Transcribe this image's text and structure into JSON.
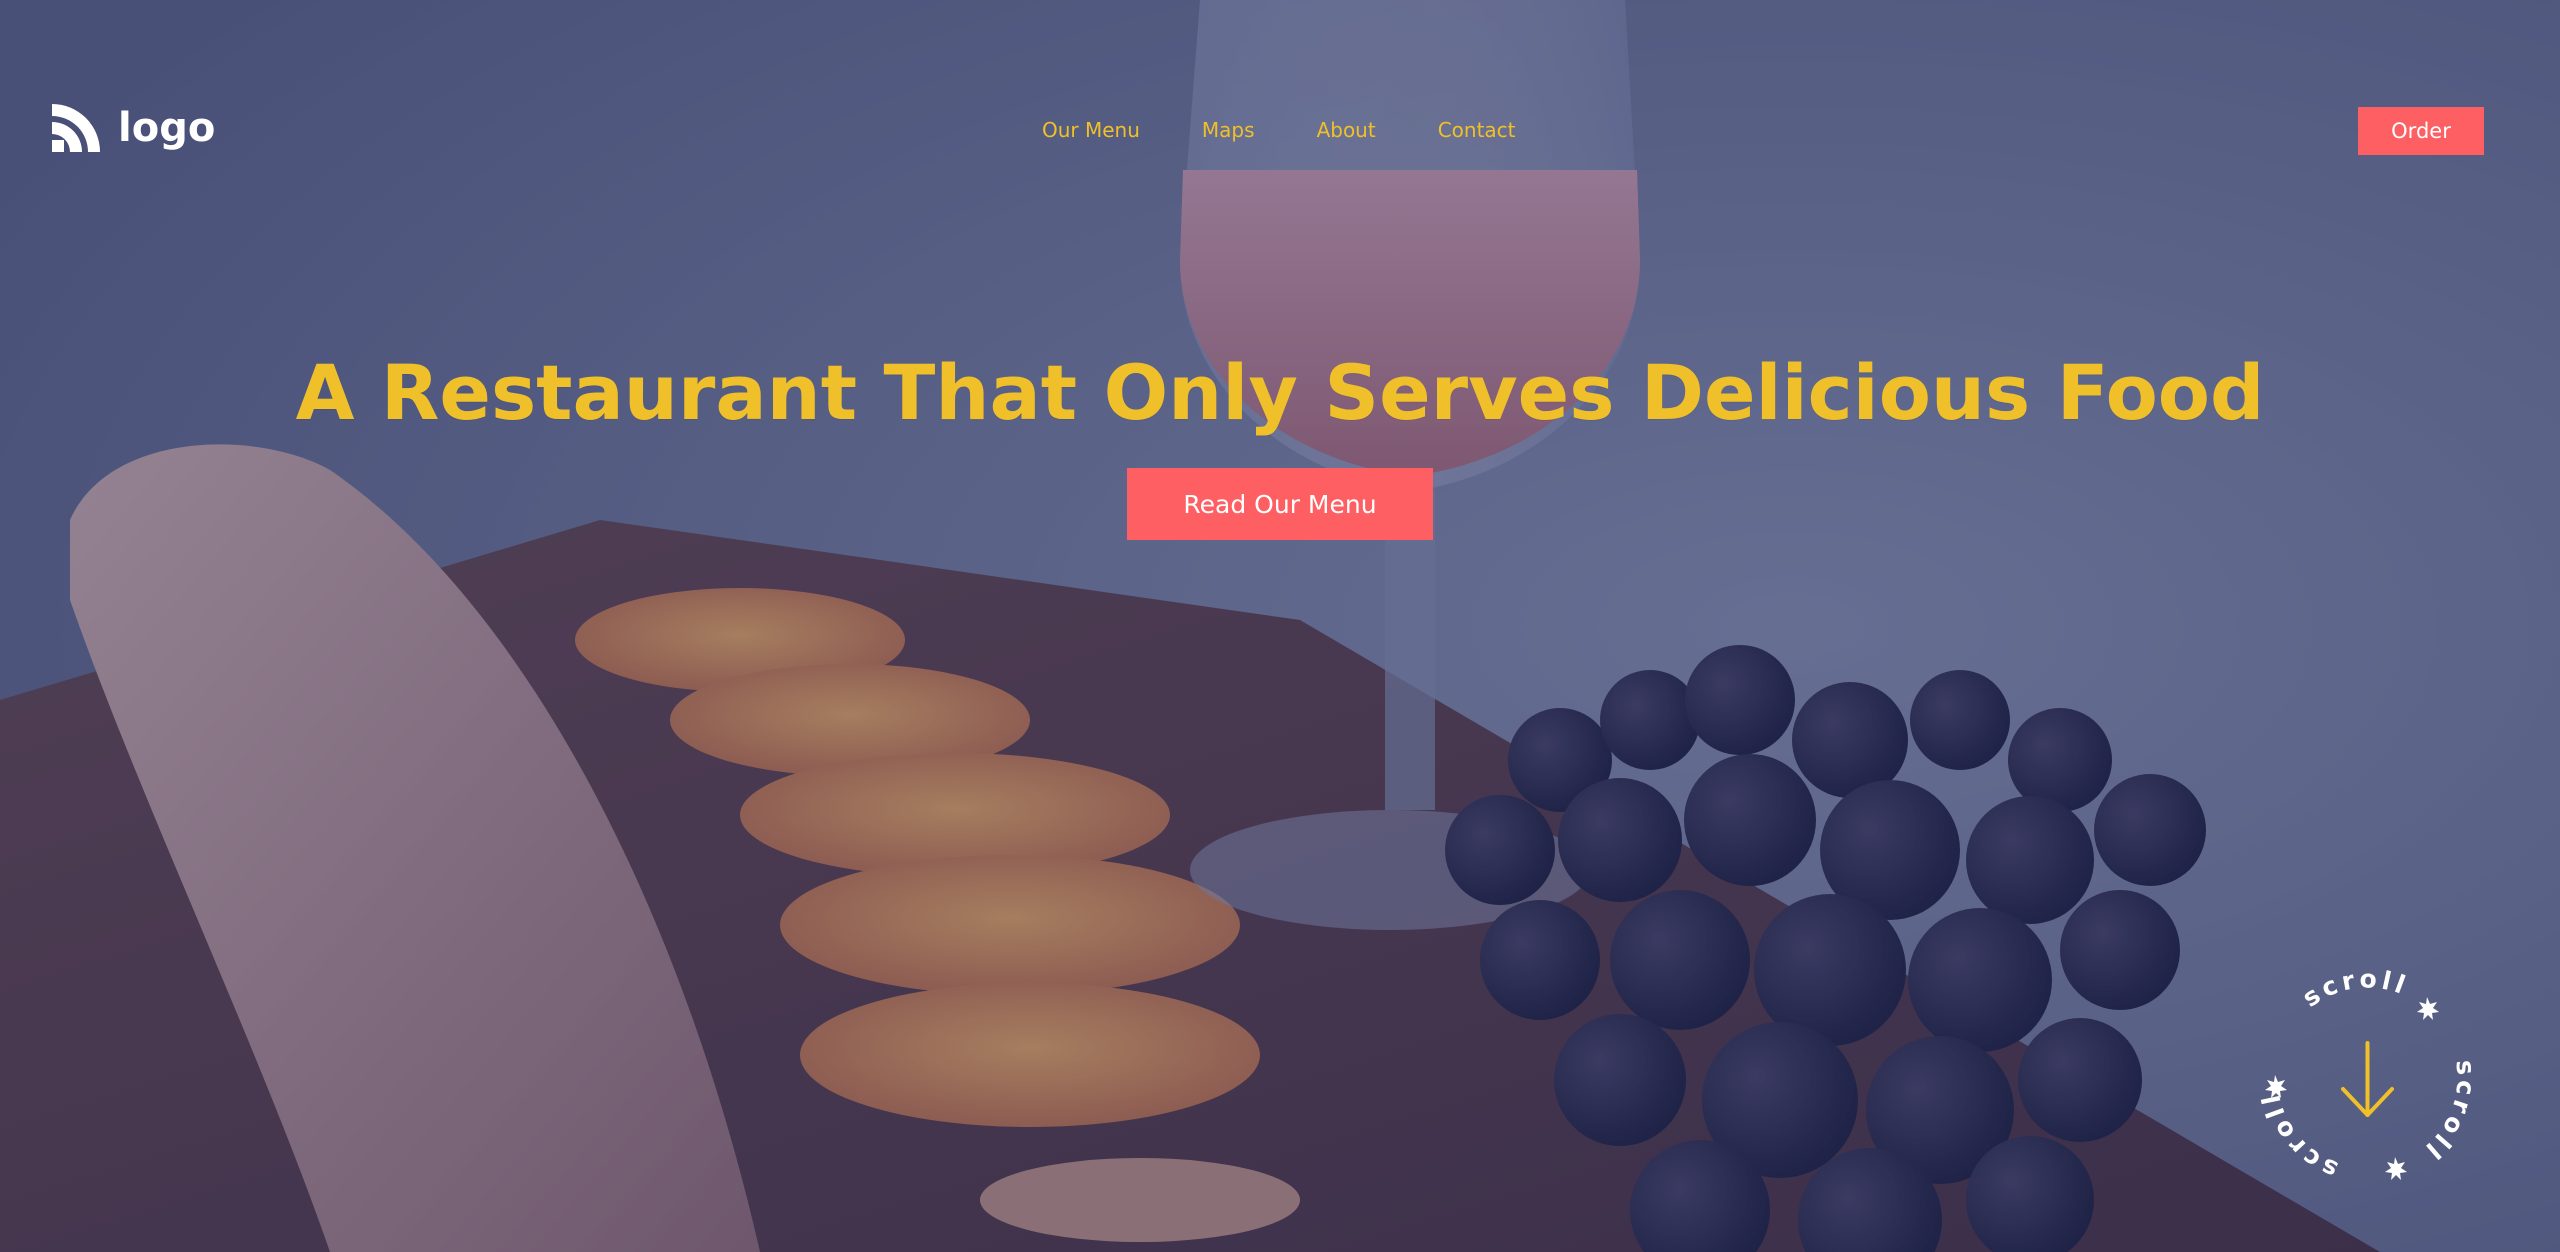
{
  "logo": {
    "text": "logo",
    "icon": "rss-wave-icon"
  },
  "nav": {
    "items": [
      {
        "label": "Our Menu"
      },
      {
        "label": "Maps"
      },
      {
        "label": "About"
      },
      {
        "label": "Contact"
      }
    ]
  },
  "header": {
    "order_label": "Order"
  },
  "hero": {
    "headline": "A Restaurant That Only Serves Delicious Food",
    "cta_label": "Read Our Menu",
    "background": "photo of bread, orange slices, grapes and rosé wine glass on a wooden board"
  },
  "scroll_badge": {
    "word": "scroll",
    "icon": "arrow-down-icon"
  },
  "colors": {
    "accent_yellow": "#f0c02a",
    "button_coral": "#fd5f62",
    "overlay_navy": "#242c5c"
  }
}
